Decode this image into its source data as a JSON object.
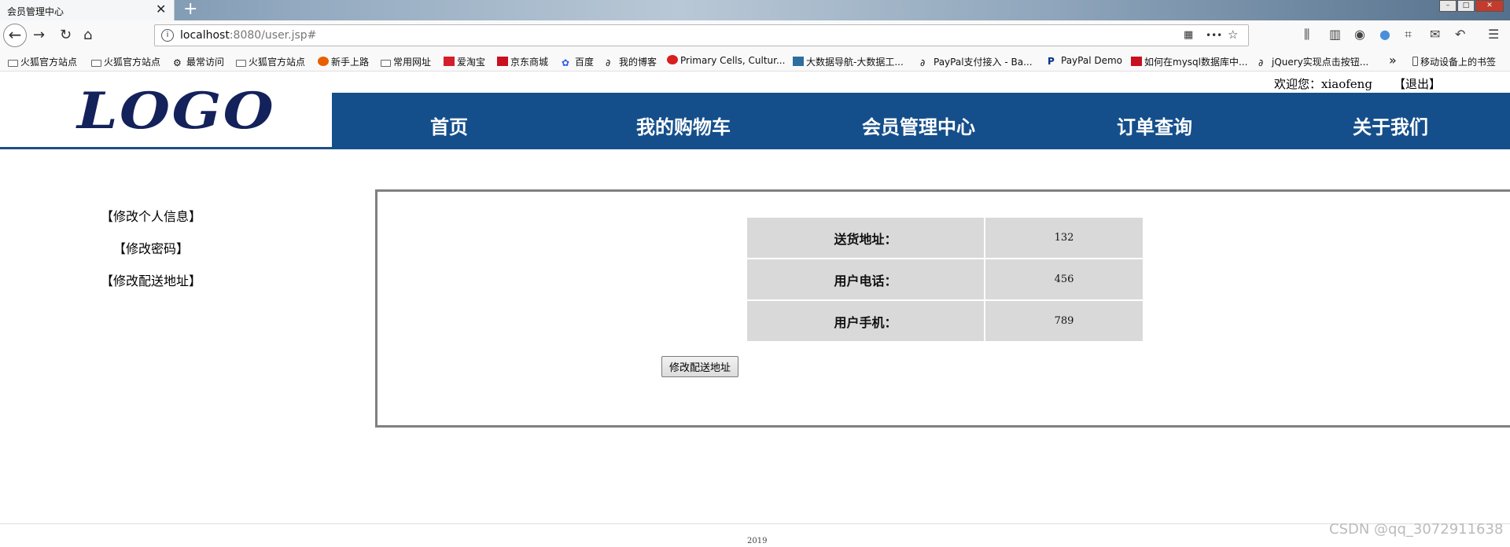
{
  "browser": {
    "tab_title": "会员管理中心",
    "tab_close": "✕",
    "new_tab": "+",
    "url_host": "localhost",
    "url_path": ":8080/user.jsp#",
    "page_actions": "•••",
    "bookmarks": [
      {
        "label": "火狐官方站点",
        "icon": "folder-icon"
      },
      {
        "label": "火狐官方站点",
        "icon": "folder-icon"
      },
      {
        "label": "最常访问",
        "icon": "gear-icon"
      },
      {
        "label": "火狐官方站点",
        "icon": "folder-icon"
      },
      {
        "label": "新手上路",
        "icon": "firefox-icon"
      },
      {
        "label": "常用网址",
        "icon": "folder-icon"
      },
      {
        "label": "爱淘宝",
        "icon": "taobao-icon"
      },
      {
        "label": "京东商城",
        "icon": "jd-icon"
      },
      {
        "label": "百度",
        "icon": "baidu-icon"
      },
      {
        "label": "我的博客",
        "icon": "blog-icon"
      },
      {
        "label": "Primary Cells, Cultur...",
        "icon": "site-icon"
      },
      {
        "label": "大数据导航-大数据工...",
        "icon": "site-icon"
      },
      {
        "label": "PayPal支付接入 - Ba...",
        "icon": "blog-icon"
      },
      {
        "label": "PayPal Demo",
        "icon": "paypal-icon"
      },
      {
        "label": "如何在mysql数据库中...",
        "icon": "csdn-icon"
      },
      {
        "label": "jQuery实现点击按钮...",
        "icon": "blog-icon"
      }
    ],
    "overflow": "»",
    "mobile_bookmarks": "移动设备上的书签"
  },
  "header": {
    "welcome": "欢迎您：xiaofeng",
    "logout": "【退出】",
    "logo": "LOGO",
    "nav": [
      "首页",
      "我的购物车",
      "会员管理中心",
      "订单查询",
      "关于我们"
    ]
  },
  "sidebar": {
    "links": [
      "【修改个人信息】",
      "【修改密码】",
      "【修改配送地址】"
    ]
  },
  "main": {
    "rows": [
      {
        "label": "送货地址：",
        "value": "132"
      },
      {
        "label": "用户电话：",
        "value": "456"
      },
      {
        "label": "用户手机：",
        "value": "789"
      }
    ],
    "submit_label": "修改配送地址"
  },
  "footer": {
    "year": "2019"
  },
  "watermark": "CSDN @qq_3072911638",
  "colors": {
    "nav_bg": "#154f8b",
    "logo": "#14225b",
    "table_cell": "#d9d9d9"
  }
}
